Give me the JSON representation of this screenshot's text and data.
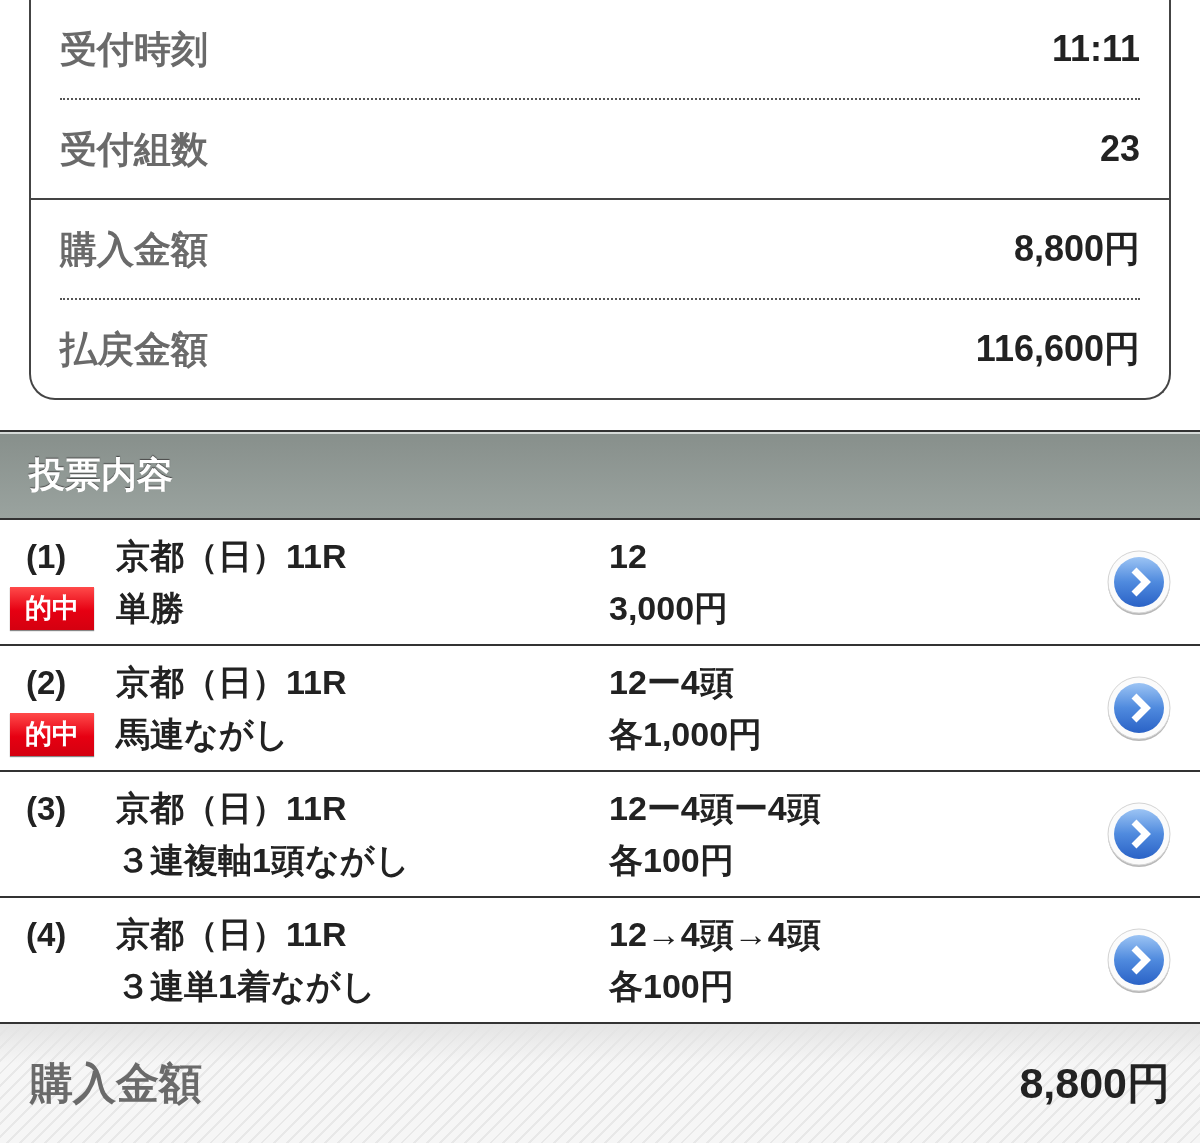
{
  "summary": {
    "groups": [
      {
        "rows": [
          {
            "label": "受付時刻",
            "value": "11:11"
          },
          {
            "label": "受付組数",
            "value": "23"
          }
        ]
      },
      {
        "rows": [
          {
            "label": "購入金額",
            "value": "8,800円"
          },
          {
            "label": "払戻金額",
            "value": "116,600円"
          }
        ]
      }
    ]
  },
  "section": {
    "title": "投票内容"
  },
  "bets": [
    {
      "number": "(1)",
      "race": "京都（日）11R",
      "hit": true,
      "badge": "的中",
      "bet_type": "単勝",
      "selection": "12",
      "amount": "3,000円"
    },
    {
      "number": "(2)",
      "race": "京都（日）11R",
      "hit": true,
      "badge": "的中",
      "bet_type": "馬連ながし",
      "selection": "12ー4頭",
      "amount": "各1,000円"
    },
    {
      "number": "(3)",
      "race": "京都（日）11R",
      "hit": false,
      "bet_type": "３連複軸1頭ながし",
      "selection": "12ー4頭ー4頭",
      "amount": "各100円"
    },
    {
      "number": "(4)",
      "race": "京都（日）11R",
      "hit": false,
      "bet_type": "３連単1着ながし",
      "selection": "12→4頭→4頭",
      "amount": "各100円"
    }
  ],
  "footer": {
    "label": "購入金額",
    "value": "8,800円"
  }
}
